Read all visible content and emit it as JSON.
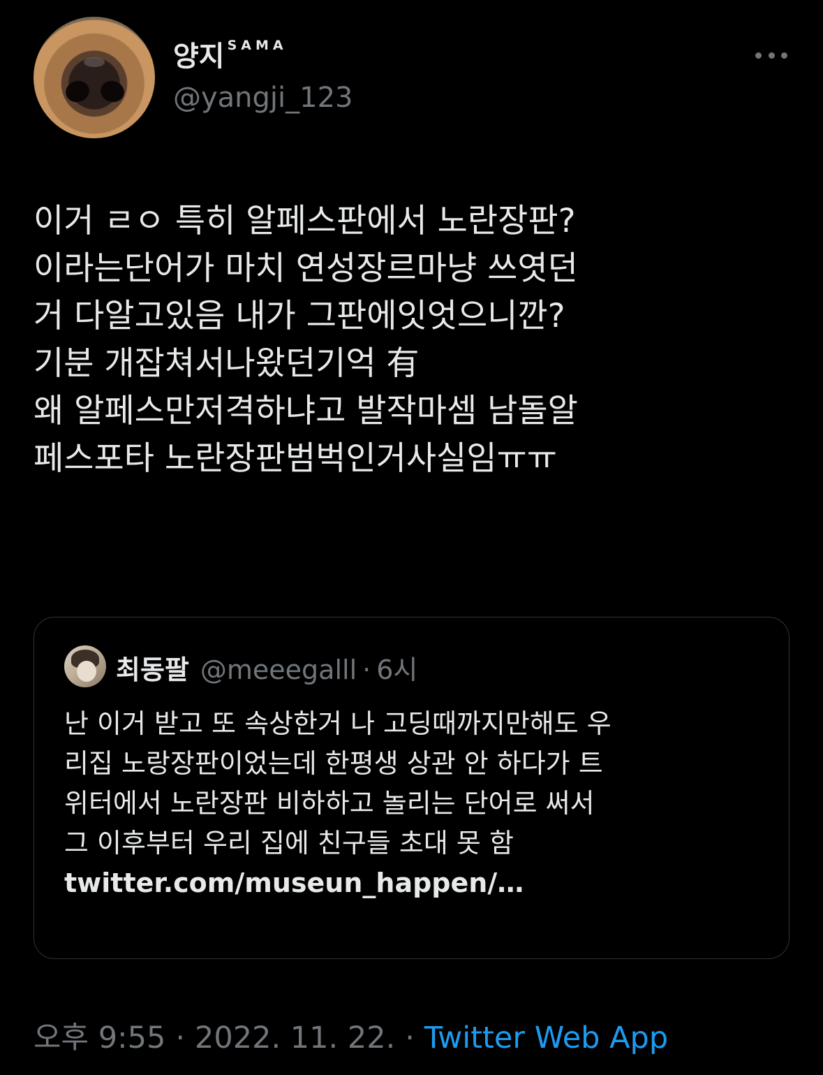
{
  "author": {
    "display_name": "양지",
    "display_name_suffix": "SAMA",
    "handle": "@yangji_123"
  },
  "menu": {
    "more_icon": "more-horizontal-icon"
  },
  "tweet": {
    "lines": [
      "이거 ㄹㅇ 특히 알페스판에서 노란장판?",
      "이라는단어가 마치 연성장르마냥 쓰엿던",
      "거 다알고있음 내가 그판에잇엇으니깐?",
      "기분 개잡쳐서나왔던기억 有",
      "왜 알페스만저격하냐고 발작마셈 남돌알",
      "페스포타 노란장판범벅인거사실임ㅠㅠ"
    ]
  },
  "quoted": {
    "display_name": "최동팔",
    "handle": "@meeegalll",
    "separator": "·",
    "time": "6시",
    "lines": [
      "난 이거 받고 또 속상한거 나 고딩때까지만해도 우",
      "리집 노랑장판이었는데 한평생 상관 안 하다가 트",
      "위터에서 노란장판 비하하고 놀리는 단어로 써서",
      "그 이후부터 우리 집에 친구들 초대 못 함"
    ],
    "link": "twitter.com/museun_happen/…"
  },
  "meta": {
    "time": "오후 9:55",
    "separator": "·",
    "date": "2022. 11. 22.",
    "source": "Twitter Web App"
  },
  "colors": {
    "background": "#000000",
    "text": "#e7e9ea",
    "muted": "#71767b",
    "accent": "#1d9bf0",
    "border": "#2f3336"
  }
}
